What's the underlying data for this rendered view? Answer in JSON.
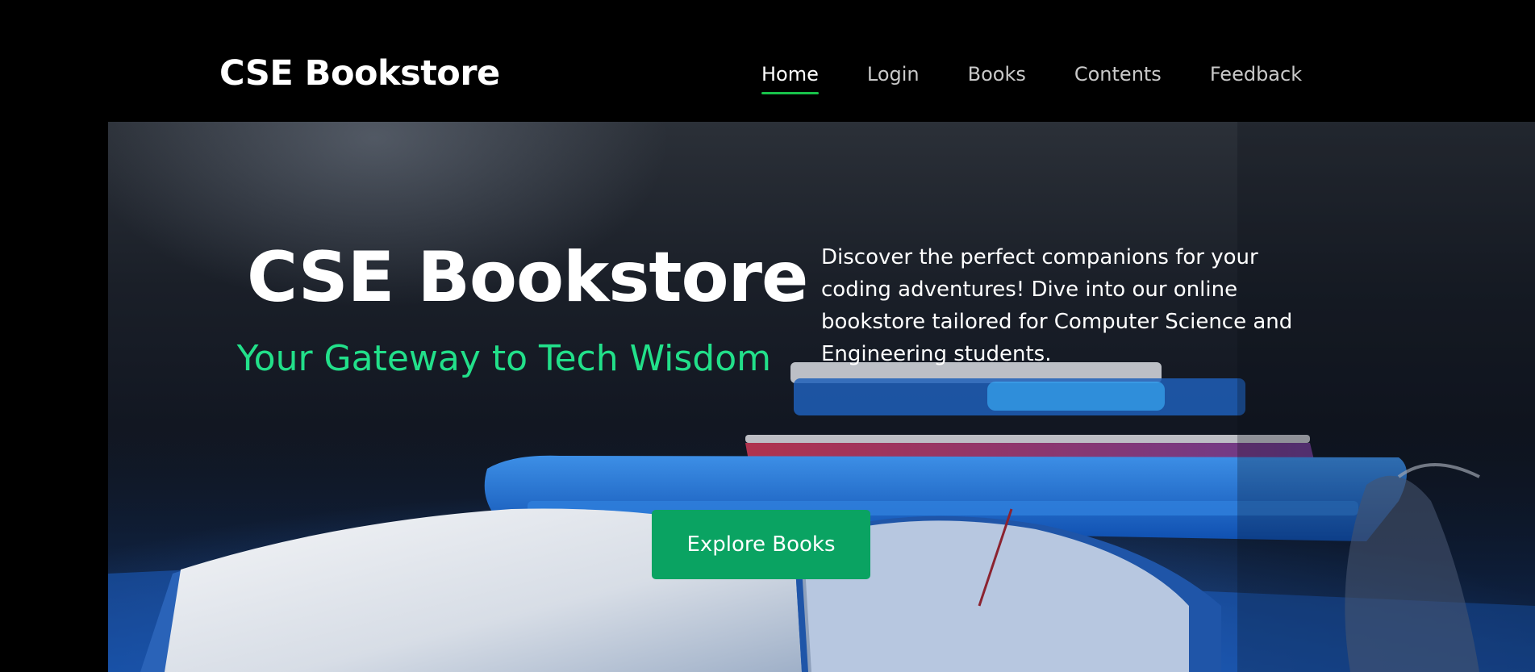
{
  "header": {
    "logo": "CSE Bookstore",
    "nav": [
      {
        "label": "Home",
        "active": true
      },
      {
        "label": "Login",
        "active": false
      },
      {
        "label": "Books",
        "active": false
      },
      {
        "label": "Contents",
        "active": false
      },
      {
        "label": "Feedback",
        "active": false
      }
    ]
  },
  "hero": {
    "title": "CSE Bookstore",
    "subtitle": "Your Gateway to Tech Wisdom",
    "description": "Discover the perfect companions for your coding adventures! Dive into our online bookstore tailored for Computer Science and Engineering students.",
    "cta_label": "Explore Books",
    "background_image": "books-on-desk-hero-image"
  },
  "colors": {
    "page_background": "#000000",
    "accent_green": "#22e08a",
    "nav_underline": "#18c24a",
    "button": "#0aa362"
  }
}
